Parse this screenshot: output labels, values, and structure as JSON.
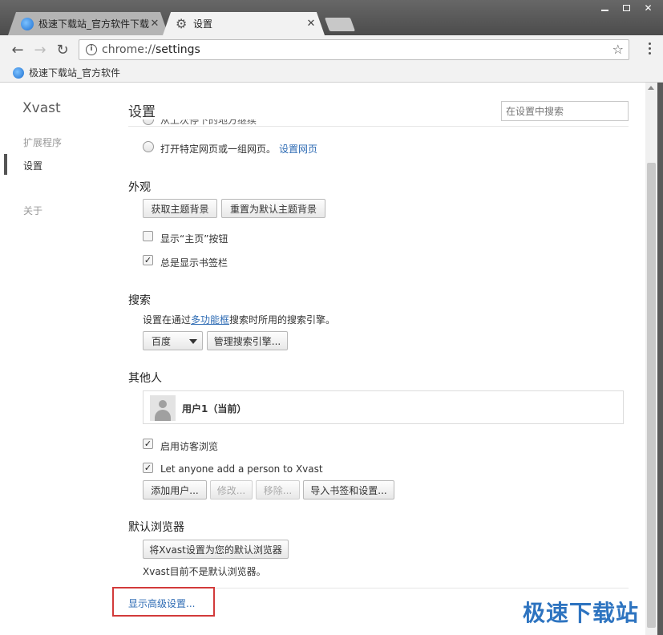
{
  "tabs": [
    {
      "title": "极速下载站_官方软件下载",
      "icon": "site-favicon"
    },
    {
      "title": "设置",
      "icon": "gear-icon"
    }
  ],
  "omnibox": {
    "scheme": "chrome://",
    "path": "settings"
  },
  "bookmarks": [
    {
      "label": "极速下载站_官方软件"
    }
  ],
  "sidebar": {
    "brand": "Xvast",
    "items": [
      {
        "label": "扩展程序",
        "active": false
      },
      {
        "label": "设置",
        "active": true
      },
      {
        "label": "关于",
        "active": false
      }
    ]
  },
  "page": {
    "title": "设置",
    "search_placeholder": "在设置中搜索"
  },
  "startup": {
    "partial_option": "从上次停下的地方继续",
    "open_pages_label": "打开特定网页或一组网页。",
    "set_pages_link": "设置网页"
  },
  "appearance": {
    "heading": "外观",
    "get_theme_button": "获取主题背景",
    "reset_theme_button": "重置为默认主题背景",
    "show_home_label": "显示“主页”按钮",
    "show_home_checked": false,
    "show_bookmarks_label": "总是显示书签栏",
    "show_bookmarks_checked": true
  },
  "search": {
    "heading": "搜索",
    "desc_before": "设置在通过",
    "desc_link": "多功能框",
    "desc_after": "搜索时所用的搜索引擎。",
    "engine_selected": "百度",
    "manage_button": "管理搜索引擎..."
  },
  "people": {
    "heading": "其他人",
    "user_name": "用户1（当前）",
    "guest_label": "启用访客浏览",
    "guest_checked": true,
    "add_person_label": "Let anyone add a person to Xvast",
    "add_person_checked": true,
    "add_user_button": "添加用户...",
    "edit_button": "修改...",
    "remove_button": "移除...",
    "import_button": "导入书签和设置..."
  },
  "default_browser": {
    "heading": "默认浏览器",
    "set_default_button": "将Xvast设置为您的默认浏览器",
    "status": "Xvast目前不是默认浏览器。"
  },
  "advanced_link": "显示高级设置...",
  "watermark": "极速下载站",
  "colors": {
    "link": "#2f6cb4",
    "highlight": "#d23a3a"
  }
}
